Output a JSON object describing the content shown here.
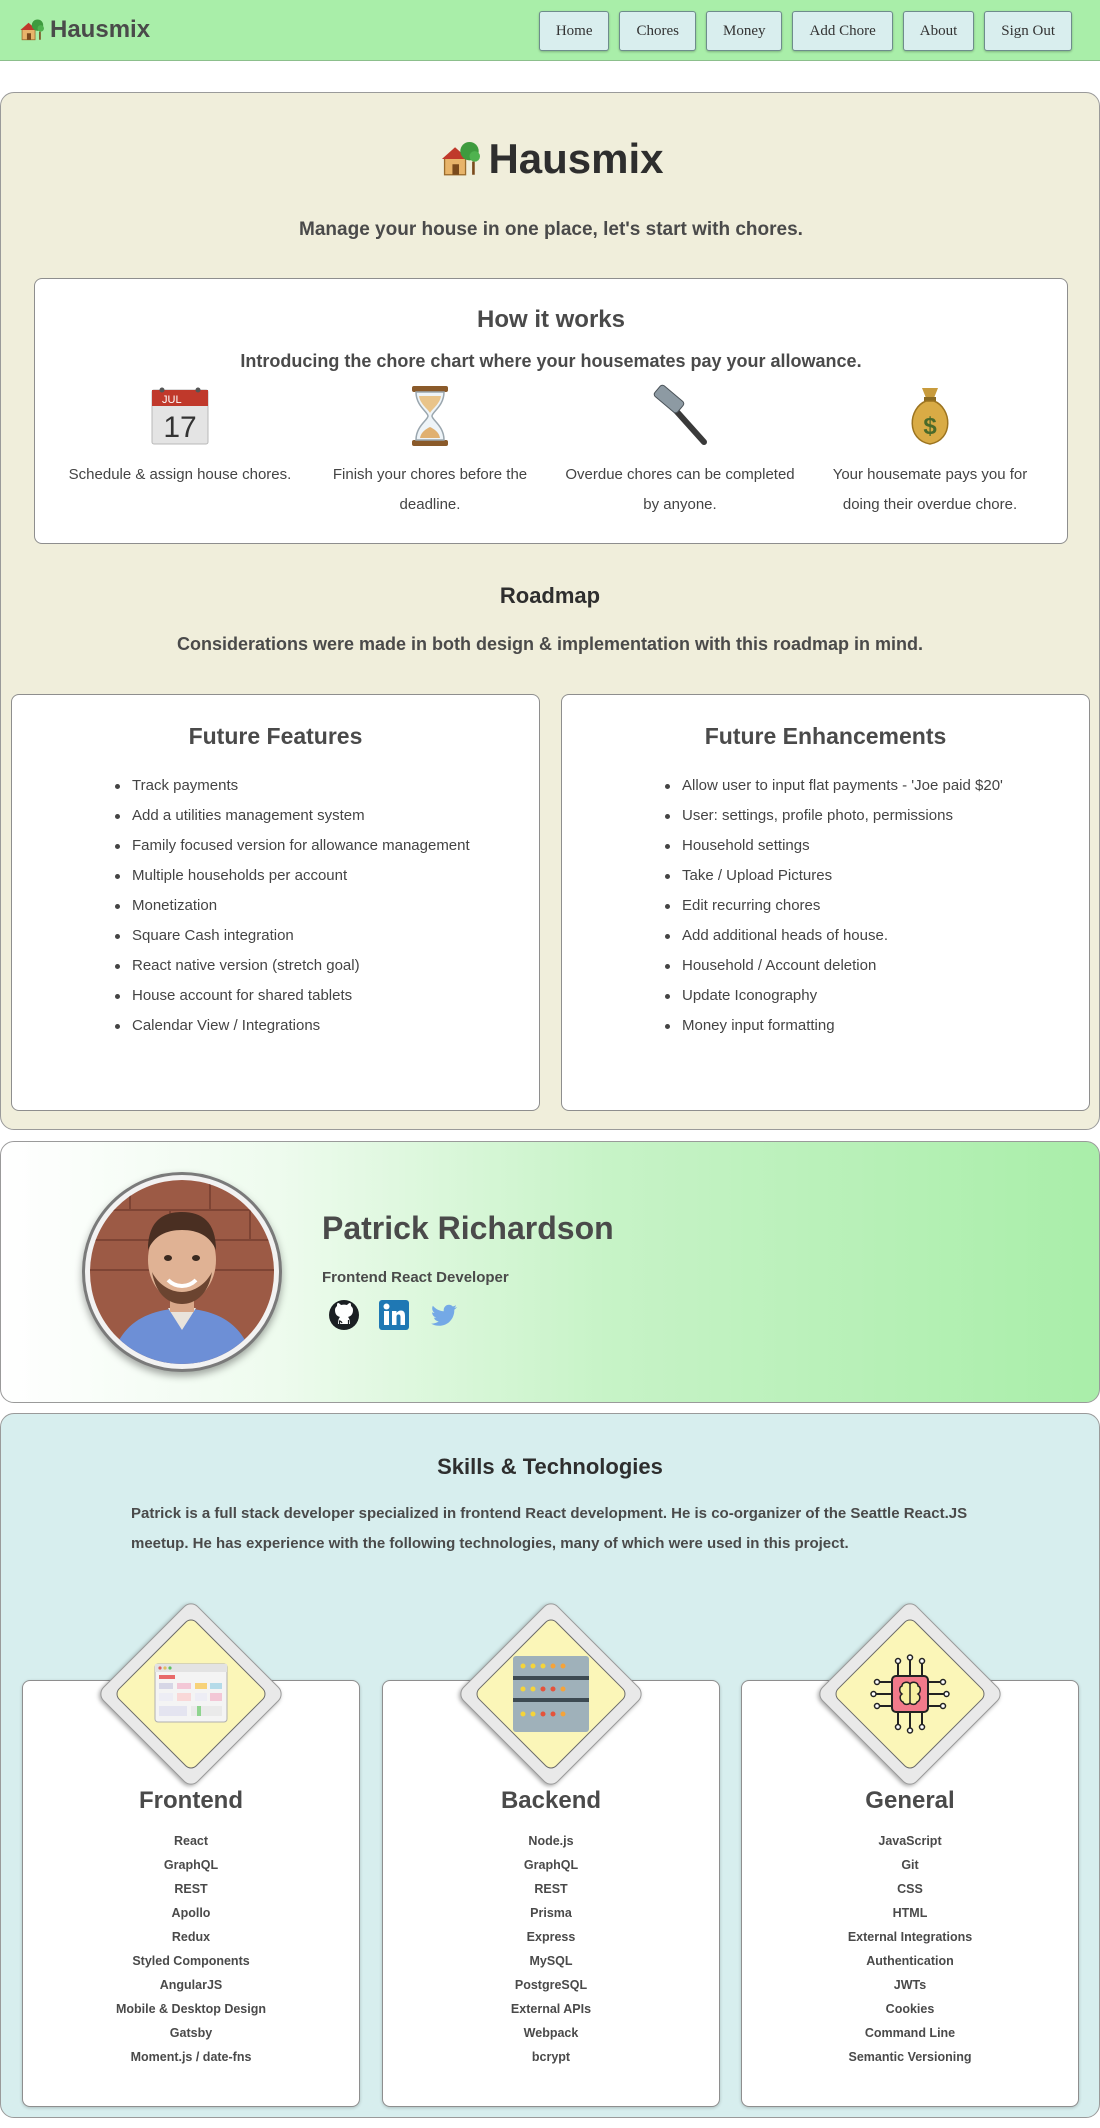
{
  "nav": {
    "brand": "Hausmix",
    "links": [
      {
        "label": "Home",
        "name": "nav-home-button"
      },
      {
        "label": "Chores",
        "name": "nav-chores-button"
      },
      {
        "label": "Money",
        "name": "nav-money-button"
      },
      {
        "label": "Add Chore",
        "name": "nav-add-chore-button"
      },
      {
        "label": "About",
        "name": "nav-about-button"
      },
      {
        "label": "Sign Out",
        "name": "nav-sign-out-button"
      }
    ]
  },
  "hero": {
    "title": "Hausmix",
    "tagline": "Manage your house in one place, let's start with chores."
  },
  "how_it_works": {
    "title": "How it works",
    "subtitle": "Introducing the chore chart where your housemates pay your allowance.",
    "calendar_month": "JUL",
    "calendar_day": "17",
    "steps": [
      {
        "icon": "calendar-icon",
        "text": "Schedule & assign house chores."
      },
      {
        "icon": "hourglass-icon",
        "text": "Finish your chores before the deadline."
      },
      {
        "icon": "hammer-icon",
        "text": "Overdue chores can be completed by anyone."
      },
      {
        "icon": "money-bag-icon",
        "text": "Your housemate pays you for doing their overdue chore."
      }
    ]
  },
  "roadmap": {
    "title": "Roadmap",
    "subtitle": "Considerations were made in both design & implementation with this roadmap in mind.",
    "features": {
      "title": "Future Features",
      "items": [
        "Track payments",
        "Add a utilities management system",
        "Family focused version for allowance management",
        "Multiple households per account",
        "Monetization",
        "Square Cash integration",
        "React native version (stretch goal)",
        "House account for shared tablets",
        "Calendar View / Integrations"
      ]
    },
    "enhancements": {
      "title": "Future Enhancements",
      "items": [
        "Allow user to input flat payments - 'Joe paid $20'",
        "User: settings, profile photo, permissions",
        "Household settings",
        "Take / Upload Pictures",
        "Edit recurring chores",
        "Add additional heads of house.",
        "Household / Account deletion",
        "Update Iconography",
        "Money input formatting"
      ]
    }
  },
  "profile": {
    "name": "Patrick Richardson",
    "role": "Frontend React Developer",
    "socials": [
      "github-icon",
      "linkedin-icon",
      "twitter-icon"
    ]
  },
  "skills": {
    "title": "Skills & Technologies",
    "description": "Patrick is a full stack developer specialized in frontend React development. He is co-organizer of the Seattle React.JS meetup. He has experience with the following technologies, many of which were used in this project.",
    "categories": [
      {
        "title": "Frontend",
        "icon": "browser-window-icon",
        "items": [
          "React",
          "GraphQL",
          "REST",
          "Apollo",
          "Redux",
          "Styled Components",
          "AngularJS",
          "Mobile & Desktop Design",
          "Gatsby",
          "Moment.js / date-fns"
        ]
      },
      {
        "title": "Backend",
        "icon": "server-icon",
        "items": [
          "Node.js",
          "GraphQL",
          "REST",
          "Prisma",
          "Express",
          "MySQL",
          "PostgreSQL",
          "External APIs",
          "Webpack",
          "bcrypt"
        ]
      },
      {
        "title": "General",
        "icon": "ai-chip-icon",
        "items": [
          "JavaScript",
          "Git",
          "CSS",
          "HTML",
          "External Integrations",
          "Authentication",
          "JWTs",
          "Cookies",
          "Command Line",
          "Semantic Versioning"
        ]
      }
    ]
  },
  "colors": {
    "nav_bg": "#a9eea9",
    "intro_bg": "#f0eedb",
    "skills_bg": "#d7eeee",
    "diamond_fill": "#fbf6b8"
  }
}
